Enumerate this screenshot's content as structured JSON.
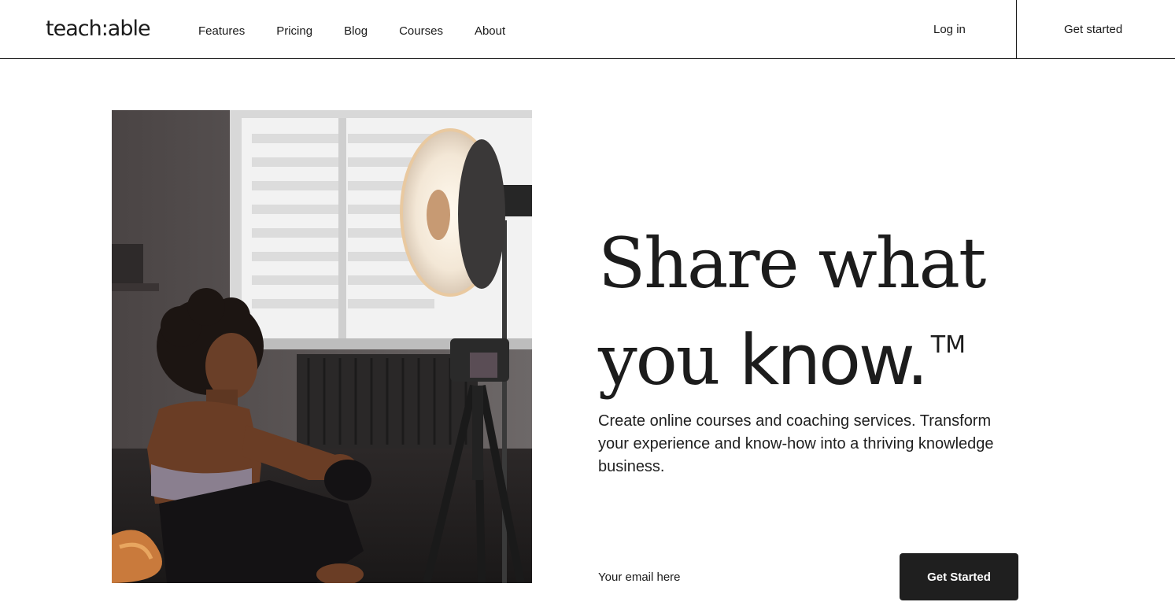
{
  "header": {
    "logo": "teach:able",
    "nav": [
      "Features",
      "Pricing",
      "Blog",
      "Courses",
      "About"
    ],
    "login": "Log in",
    "get_started": "Get started"
  },
  "hero": {
    "headline_line1": "Share what",
    "headline_line2_a": "you ",
    "headline_line2_b": "know.",
    "trademark": "TM",
    "subtext": "Create online courses and coaching services. Transform your experience and know-how into a thriving knowledge business.",
    "email_placeholder": "Your email here",
    "cta_label": "Get Started"
  },
  "colors": {
    "text": "#1a1a1a",
    "cta_bg": "#1f1f1f",
    "cta_text": "#ffffff",
    "background": "#ffffff"
  },
  "image": {
    "alt": "photo-woman-sitting-beside-ring-light-and-camera-tripod"
  }
}
